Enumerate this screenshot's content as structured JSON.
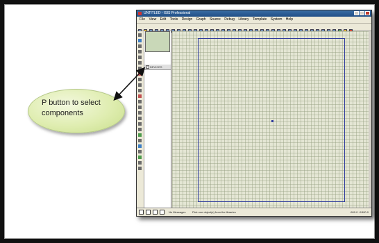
{
  "callout": {
    "line1": "P button to select",
    "line2": "components"
  },
  "app": {
    "title": "UNTITLED - ISIS Professional",
    "menu": [
      "File",
      "View",
      "Edit",
      "Tools",
      "Design",
      "Graph",
      "Source",
      "Debug",
      "Library",
      "Template",
      "System",
      "Help"
    ],
    "left_tool_p": "P",
    "devices_header": "DEVICES",
    "devices_pick_button": "P",
    "status_message": "No Messages",
    "status_hint": "Pick one object(s) from the libraries",
    "status_coords": "-900.0  +1500.0"
  },
  "colors": {
    "callout_fill": "#dfedb0",
    "canvas": "#e4e6d4",
    "sheet_border": "#2e3a9c",
    "title_bar": "#1f4e86"
  }
}
